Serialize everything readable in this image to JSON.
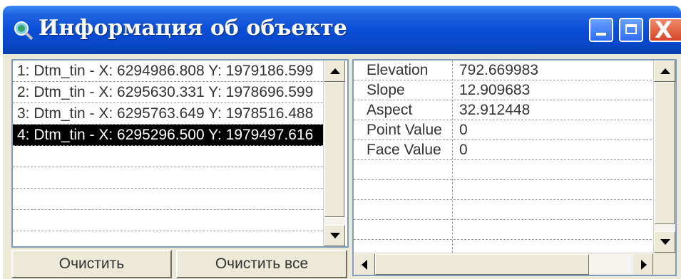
{
  "window": {
    "title": "Информация об объекте",
    "icon": "magnifier-globe-icon",
    "controls": [
      "minimize-icon",
      "maximize-icon",
      "close-icon"
    ]
  },
  "objects_list": {
    "items": [
      {
        "label": "1:  Dtm_tin - X: 6294986.808 Y: 1979186.599",
        "selected": false
      },
      {
        "label": "2:  Dtm_tin - X: 6295630.331 Y: 1978696.599",
        "selected": false
      },
      {
        "label": "3:  Dtm_tin - X: 6295763.649 Y: 1978516.488",
        "selected": false
      },
      {
        "label": "4:  Dtm_tin - X: 6295296.500 Y: 1979497.616",
        "selected": true
      }
    ]
  },
  "buttons": {
    "clear": "Очистить",
    "clear_all": "Очистить все"
  },
  "properties": [
    {
      "name": "Elevation",
      "value": "792.669983"
    },
    {
      "name": "Slope",
      "value": "12.909683"
    },
    {
      "name": "Aspect",
      "value": "32.912448"
    },
    {
      "name": "Point Value",
      "value": "0"
    },
    {
      "name": "Face Value",
      "value": "0"
    }
  ],
  "colors": {
    "titlebar": "#0a4fd8",
    "selection": "#000000",
    "face": "#ece9d8"
  }
}
